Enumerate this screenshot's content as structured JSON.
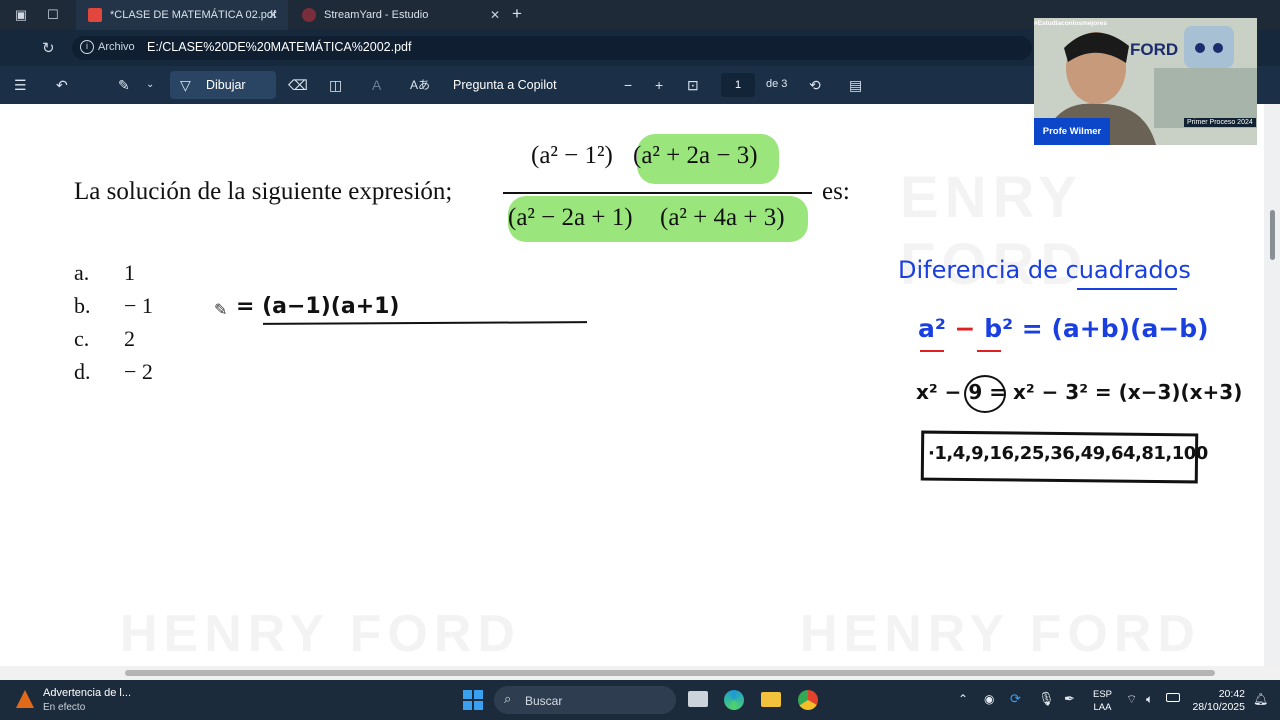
{
  "browser": {
    "tabs": [
      {
        "label": "*CLASE DE MATEMÁTICA 02.pdf",
        "active": true
      },
      {
        "label": "StreamYard - Estudio",
        "active": false
      }
    ],
    "address_label": "Archivo",
    "url": "E:/CLASE%20DE%20MATEMÁTICA%2002.pdf"
  },
  "pdf_toolbar": {
    "draw_label": "Dibujar",
    "copilot_label": "Pregunta a Copilot",
    "page_current": "1",
    "page_total": "de 3"
  },
  "document": {
    "question": "La solución de la siguiente expresión;",
    "question_end": "es:",
    "numerator": [
      "(a² − 1²)",
      "(a² + 2a − 3)"
    ],
    "denominator": [
      "(a² − 2a + 1)",
      "(a² + 4a + 3)"
    ],
    "options": [
      {
        "letter": "a.",
        "value": "1"
      },
      {
        "letter": "b.",
        "value": "− 1"
      },
      {
        "letter": "c.",
        "value": "2"
      },
      {
        "letter": "d.",
        "value": "− 2"
      }
    ],
    "handwritten_work": "= (a−1)(a+1)",
    "notes": {
      "title": "Diferencia de cuadrados",
      "formula_lhs_a": "a²",
      "formula_minus": "−",
      "formula_lhs_b": "b²",
      "formula_rhs": "= (a+b)(a−b)",
      "example": "x² − 9 = x² − 3² = (x−3)(x+3)",
      "squares": "·1,4,9,16,25,36,49,64,81,100"
    },
    "colors": {
      "highlight": "#8fe36f",
      "ink_blue": "#1a3fe0",
      "ink_red": "#e02020",
      "ink_black": "#111111"
    }
  },
  "webcam": {
    "tag": "#Estudiaconlosmejores",
    "brand": "FORD",
    "name": "Profe Wilmer",
    "process": "Primer Proceso 2024"
  },
  "taskbar": {
    "notification_title": "Advertencia de l...",
    "notification_sub": "En efecto",
    "search_placeholder": "Buscar",
    "lang": "ESP",
    "lang_sub": "LAA",
    "time": "20:42",
    "date": "28/10/2025"
  }
}
